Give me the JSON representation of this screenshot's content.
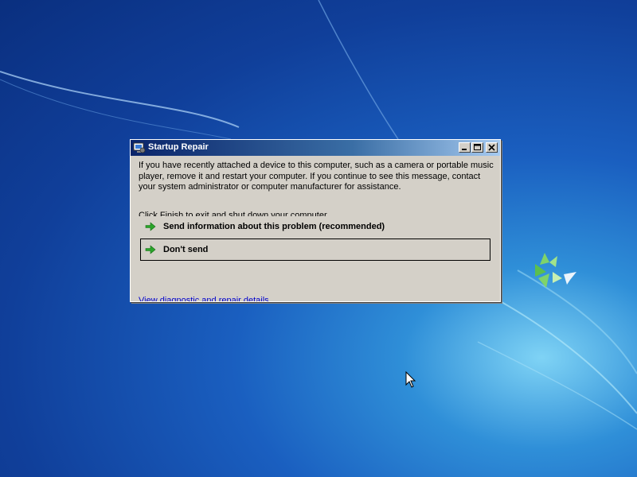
{
  "dialog": {
    "title": "Startup Repair",
    "message": "If you have recently attached a device to this computer, such as a camera or portable music player, remove it and restart your computer. If you continue to see this message, contact your system administrator or computer manufacturer for assistance.",
    "finish_text": "Click Finish to exit and shut down your computer",
    "options": [
      {
        "label": "Send information about this problem (recommended)"
      },
      {
        "label": "Don't send"
      }
    ],
    "details_link": "View diagnostic and repair details"
  },
  "colors": {
    "titlebar_start": "#0a246a",
    "titlebar_end": "#a6caf0",
    "dialog_bg": "#d4d0c8",
    "arrow_green": "#2aa52a",
    "link": "#0000cc"
  },
  "icons": {
    "title": "startup-repair-icon",
    "option_arrow": "green-arrow-icon",
    "minimize": "minimize-icon",
    "maximize": "maximize-icon",
    "close": "close-icon",
    "cursor": "mouse-pointer-icon"
  }
}
